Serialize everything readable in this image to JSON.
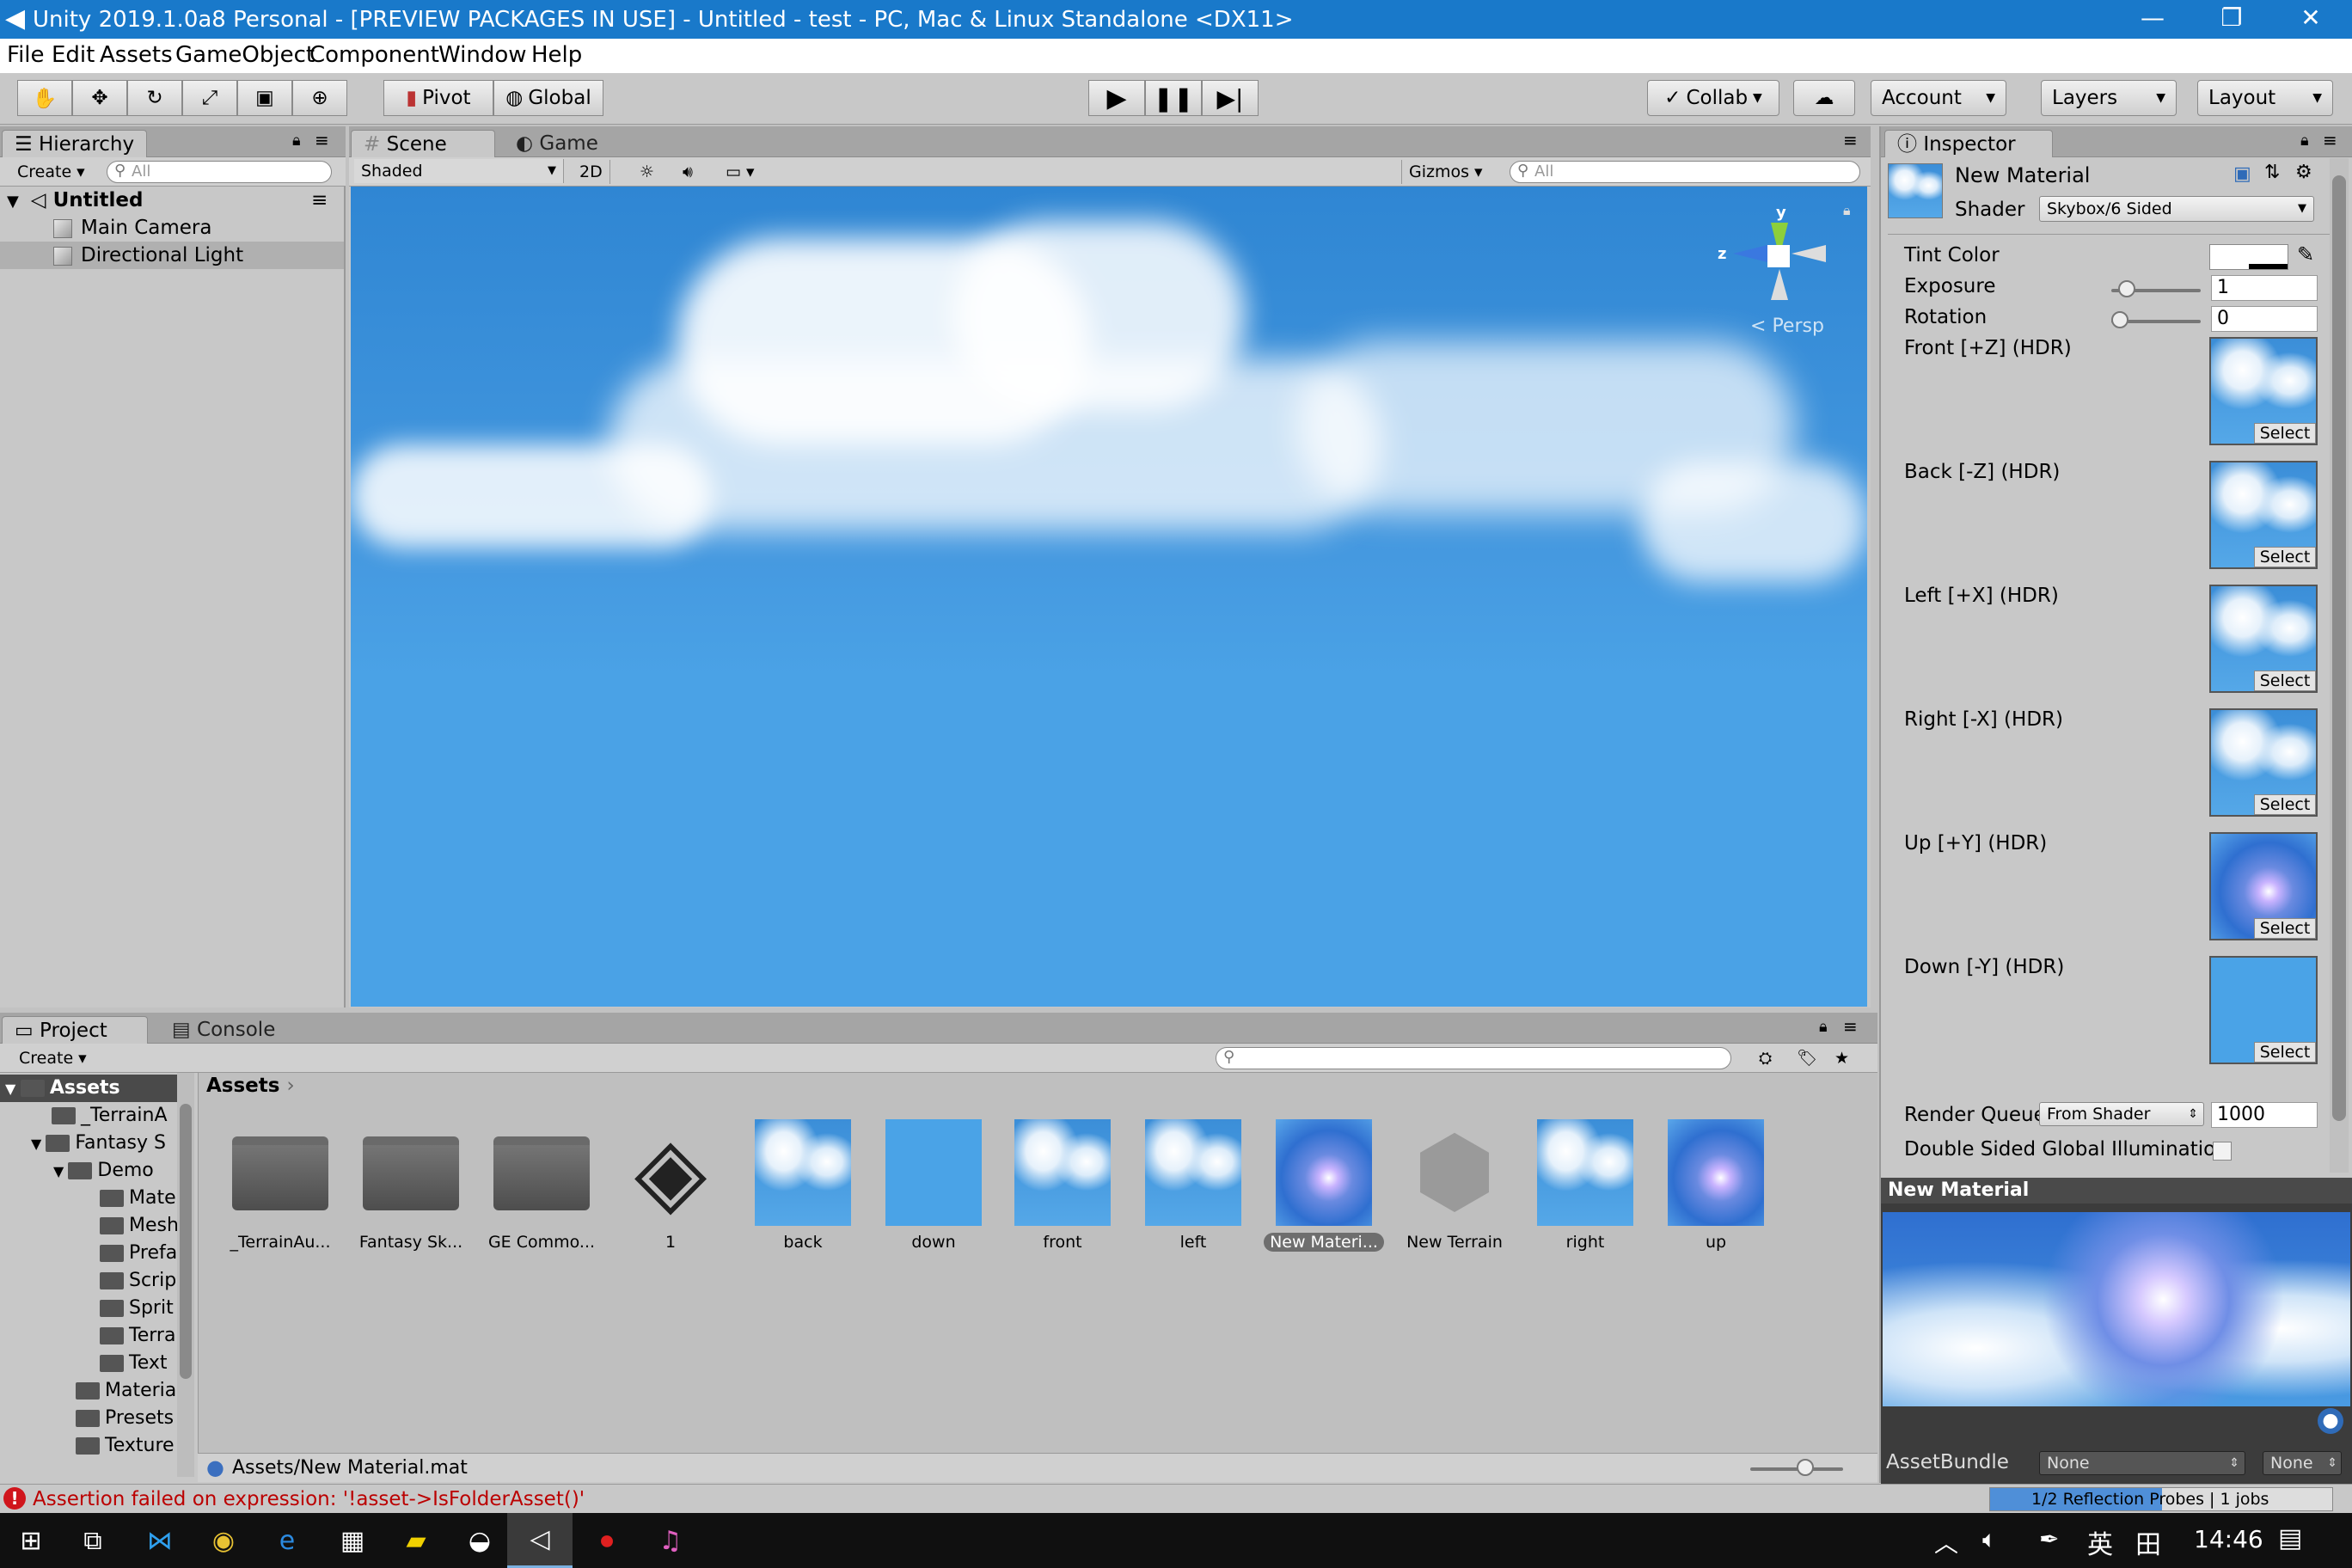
{
  "window": {
    "title": "Unity 2019.1.0a8 Personal - [PREVIEW PACKAGES IN USE] - Untitled - test - PC, Mac & Linux Standalone <DX11>",
    "min": "—",
    "max": "❐",
    "close": "✕"
  },
  "menu": [
    "File",
    "Edit",
    "Assets",
    "GameObject",
    "Component",
    "Window",
    "Help"
  ],
  "toolbar": {
    "pivot": "Pivot",
    "global": "Global",
    "collab": "Collab",
    "account": "Account",
    "layers": "Layers",
    "layout": "Layout"
  },
  "hierarchy": {
    "tab": "Hierarchy",
    "create": "Create",
    "search_placeholder": "All",
    "scene": "Untitled",
    "items": [
      "Main Camera",
      "Directional Light"
    ]
  },
  "scene": {
    "tab_scene": "Scene",
    "tab_game": "Game",
    "shading": "Shaded",
    "mode2d": "2D",
    "gizmos": "Gizmos",
    "search_placeholder": "All",
    "persp": "Persp",
    "axis_y": "y",
    "axis_z": "z"
  },
  "inspector": {
    "tab": "Inspector",
    "name": "New Material",
    "shader_label": "Shader",
    "shader": "Skybox/6 Sided",
    "tint_label": "Tint Color",
    "exposure_label": "Exposure",
    "exposure": "1",
    "exposure_slider": 0.1,
    "rotation_label": "Rotation",
    "rotation": "0",
    "rotation_slider": 0.0,
    "textures": [
      {
        "label": "Front [+Z]   (HDR)",
        "tex": "front"
      },
      {
        "label": "Back [-Z]   (HDR)",
        "tex": "back"
      },
      {
        "label": "Left [+X]   (HDR)",
        "tex": "left"
      },
      {
        "label": "Right [-X]   (HDR)",
        "tex": "right"
      },
      {
        "label": "Up [+Y]   (HDR)",
        "tex": "up"
      },
      {
        "label": "Down [-Y]   (HDR)",
        "tex": "down"
      }
    ],
    "select": "Select",
    "render_queue_label": "Render Queue",
    "render_queue_mode": "From Shader",
    "render_queue": "1000",
    "double_sided_label": "Double Sided Global Illuminatio",
    "preview_title": "New Material",
    "assetbundle_label": "AssetBundle",
    "assetbundle": "None",
    "assetbundle_variant": "None"
  },
  "project": {
    "tab_project": "Project",
    "tab_console": "Console",
    "create": "Create",
    "breadcrumb": "Assets",
    "tree": [
      "Assets",
      "_TerrainA",
      "Fantasy S",
      "Demo",
      "Mate",
      "Mesh",
      "Prefa",
      "Scrip",
      "Sprit",
      "Terra",
      "Text",
      "Materia",
      "Presets",
      "Texture"
    ],
    "assets": [
      {
        "name": "_TerrainAu...",
        "kind": "folder"
      },
      {
        "name": "Fantasy Sk...",
        "kind": "folder"
      },
      {
        "name": "GE Commo...",
        "kind": "folder"
      },
      {
        "name": "1",
        "kind": "unity"
      },
      {
        "name": "back",
        "kind": "sky"
      },
      {
        "name": "down",
        "kind": "plain"
      },
      {
        "name": "front",
        "kind": "sky"
      },
      {
        "name": "left",
        "kind": "sky"
      },
      {
        "name": "New Materi...",
        "kind": "up"
      },
      {
        "name": "New Terrain",
        "kind": "terrain"
      },
      {
        "name": "right",
        "kind": "sky"
      },
      {
        "name": "up",
        "kind": "up"
      }
    ],
    "selected_path": "Assets/New Material.mat"
  },
  "status": {
    "error": "Assertion failed on expression: '!asset->IsFolderAsset()'",
    "progress": "1/2 Reflection Probes | 1 jobs",
    "progress_fraction": 0.5
  },
  "taskbar": {
    "time": "14:46",
    "ime": "英"
  }
}
